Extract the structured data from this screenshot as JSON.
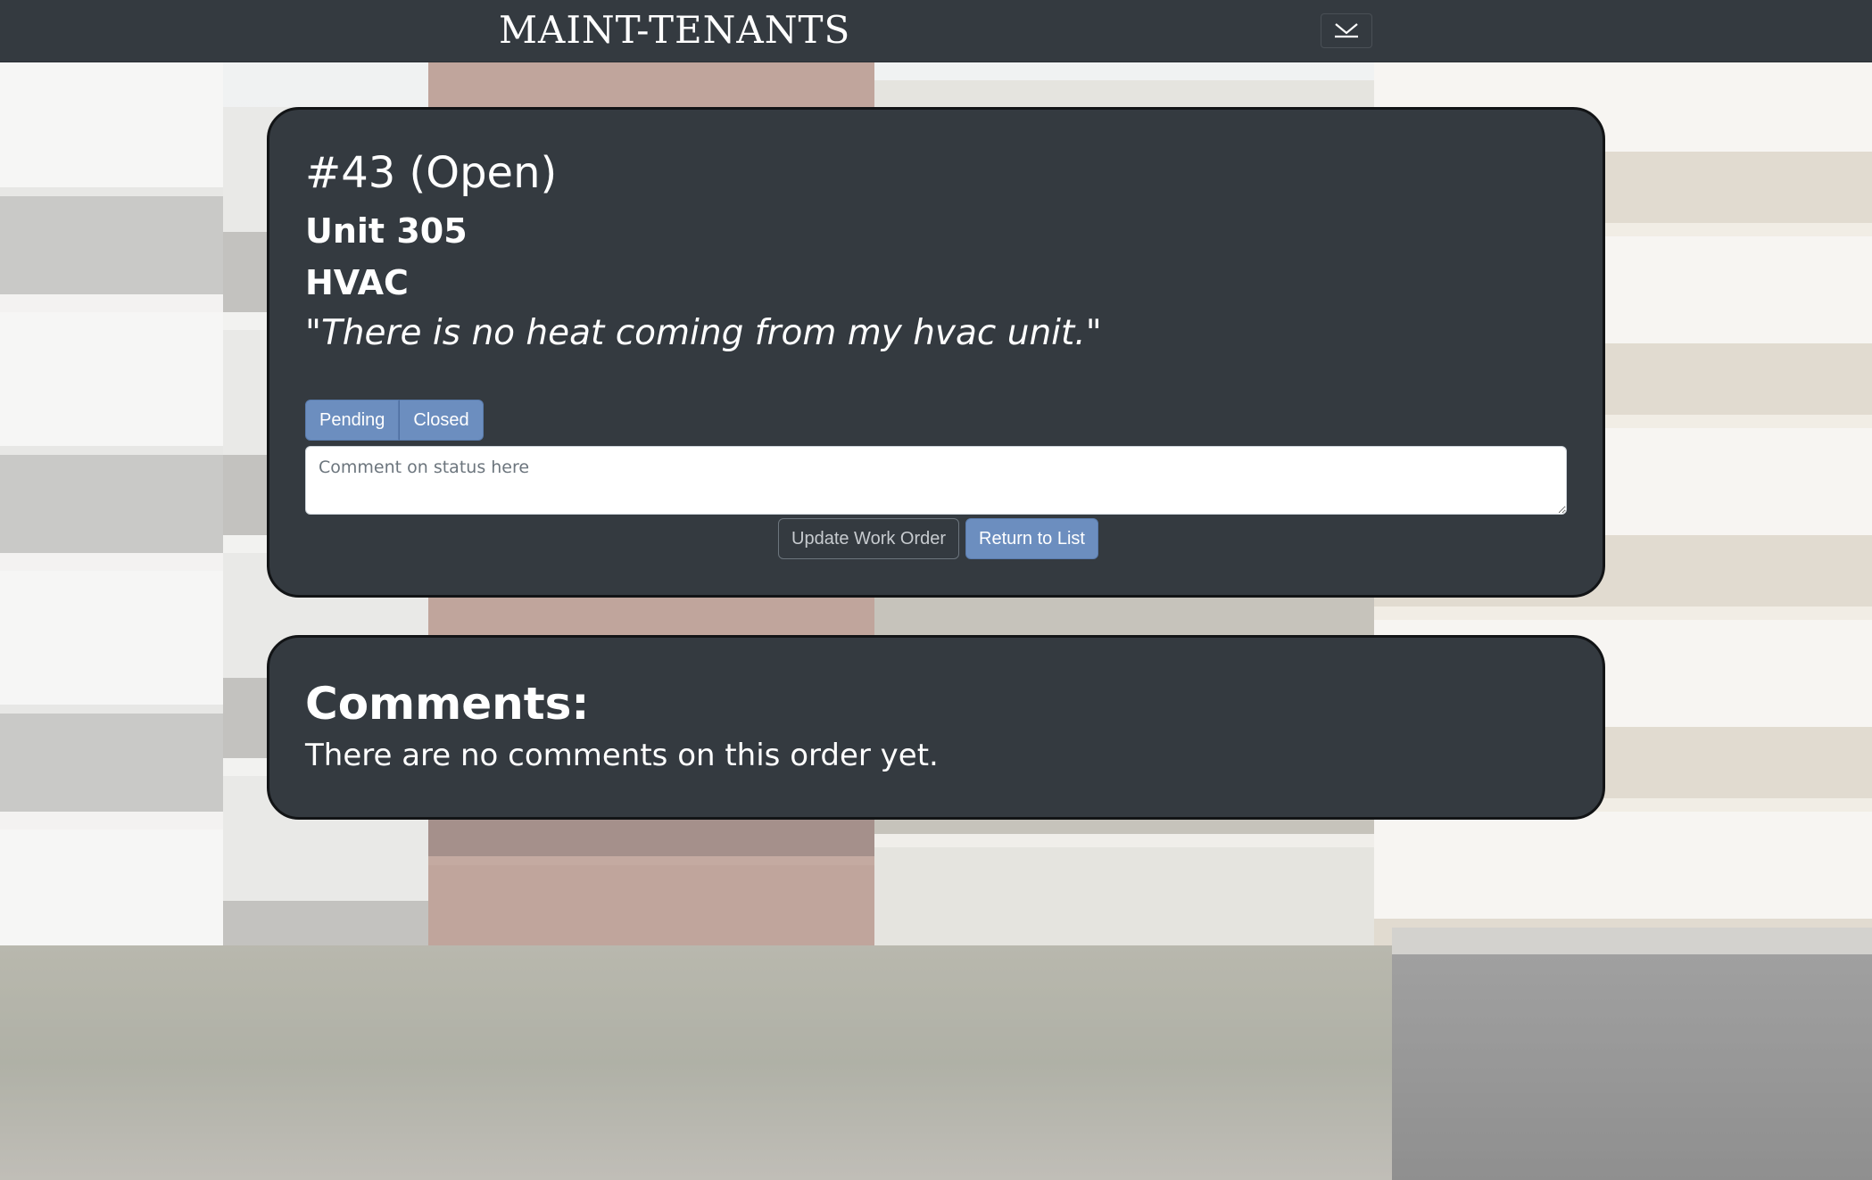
{
  "navbar": {
    "brand": "MAINT-TENANTS",
    "toggle_icon": "chevron-down-icon"
  },
  "work_order": {
    "title": "#43 (Open)",
    "unit": "Unit 305",
    "category": "HVAC",
    "description": "\"There is no heat coming from my hvac unit.\"",
    "status_buttons": [
      "Pending",
      "Closed"
    ],
    "comment_placeholder": "Comment on status here",
    "comment_value": "",
    "update_label": "Update Work Order",
    "return_label": "Return to List"
  },
  "comments": {
    "title": "Comments:",
    "empty_message": "There are no comments on this order yet."
  },
  "colors": {
    "navbar_bg": "#343a40",
    "card_bg": "#343a40",
    "primary_button": "#6c8ebf",
    "secondary_button_border": "#6c757d",
    "text": "#ffffff"
  }
}
